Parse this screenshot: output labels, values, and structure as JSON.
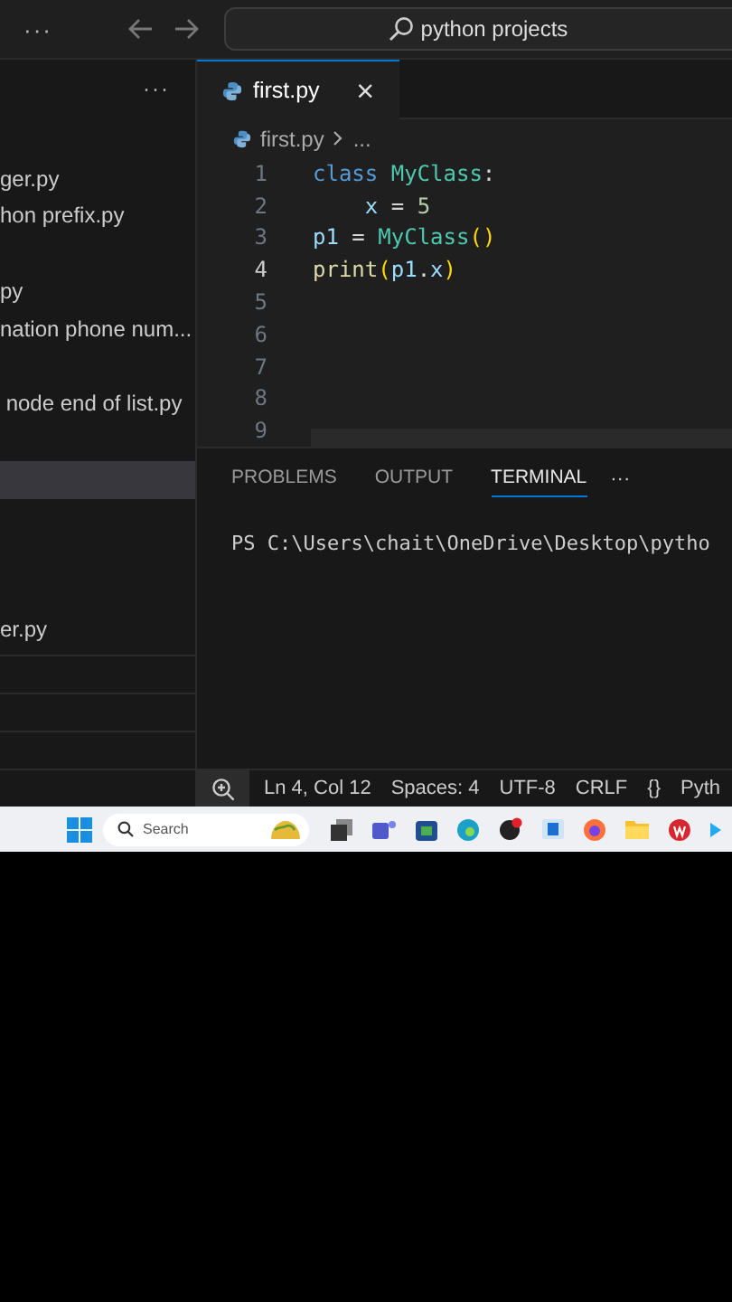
{
  "title_bar": {
    "more": "···",
    "search": "python projects"
  },
  "explorer": {
    "more": "···",
    "rows": [
      {
        "label": "ger.py",
        "selected": false
      },
      {
        "label": "hon prefix.py",
        "selected": false
      },
      {
        "selected": false
      },
      {
        "label": "py",
        "selected": false
      },
      {
        "label": "nation phone num...",
        "selected": false
      },
      {
        "selected": false
      },
      {
        "label": " node end of list.py",
        "selected": false
      },
      {
        "selected": false
      },
      {
        "selected": true
      },
      {
        "selected": false
      },
      {
        "selected": false
      },
      {
        "selected": false
      },
      {
        "label": "er.py",
        "selected": false
      }
    ]
  },
  "editor": {
    "tabs": [
      {
        "label": "first.py",
        "selected": true,
        "close": "×"
      }
    ],
    "breadcrumb": [
      "first.py",
      "..."
    ],
    "lines": [
      {
        "number": "1",
        "current": false,
        "tokens": [
          {
            "text": "class",
            "kind": "keyword"
          },
          {
            "text": " MyClass",
            "kind": "class"
          },
          {
            "text": ":"
          }
        ]
      },
      {
        "number": "2",
        "current": false,
        "tokens": [
          {
            "text": "    x",
            "kind": "var"
          },
          {
            "text": " = "
          },
          {
            "text": "5",
            "kind": "num"
          }
        ]
      },
      {
        "number": "3",
        "current": false,
        "tokens": [
          {
            "text": "p1",
            "kind": "var"
          },
          {
            "text": " = "
          },
          {
            "text": "MyClass",
            "kind": "class"
          },
          {
            "text": "()",
            "kind": "paren"
          }
        ]
      },
      {
        "number": "4",
        "current": true,
        "tokens": [
          {
            "text": "print",
            "kind": "func"
          },
          {
            "text": "(",
            "kind": "paren"
          },
          {
            "text": "p1",
            "kind": "var"
          },
          {
            "text": "."
          },
          {
            "text": "x",
            "kind": "var"
          },
          {
            "text": ")",
            "kind": "paren"
          }
        ]
      },
      {
        "number": "5",
        "current": false
      },
      {
        "number": "6",
        "current": false
      },
      {
        "number": "7",
        "current": false
      },
      {
        "number": "8",
        "current": false
      },
      {
        "number": "9",
        "current": false
      }
    ]
  },
  "panel": {
    "tabs": [
      {
        "label": "PROBLEMS",
        "selected": false
      },
      {
        "label": "OUTPUT",
        "selected": false
      },
      {
        "label": "TERMINAL",
        "selected": true
      }
    ],
    "more": "···",
    "terminal": "PS C:\\Users\\chait\\OneDrive\\Desktop\\pytho"
  },
  "status_bar": {
    "items": [
      "Ln 4, Col 12",
      "Spaces: 4",
      "UTF-8",
      "CRLF",
      "{}",
      "Pyth"
    ]
  },
  "taskbar": {
    "search": "Search"
  }
}
